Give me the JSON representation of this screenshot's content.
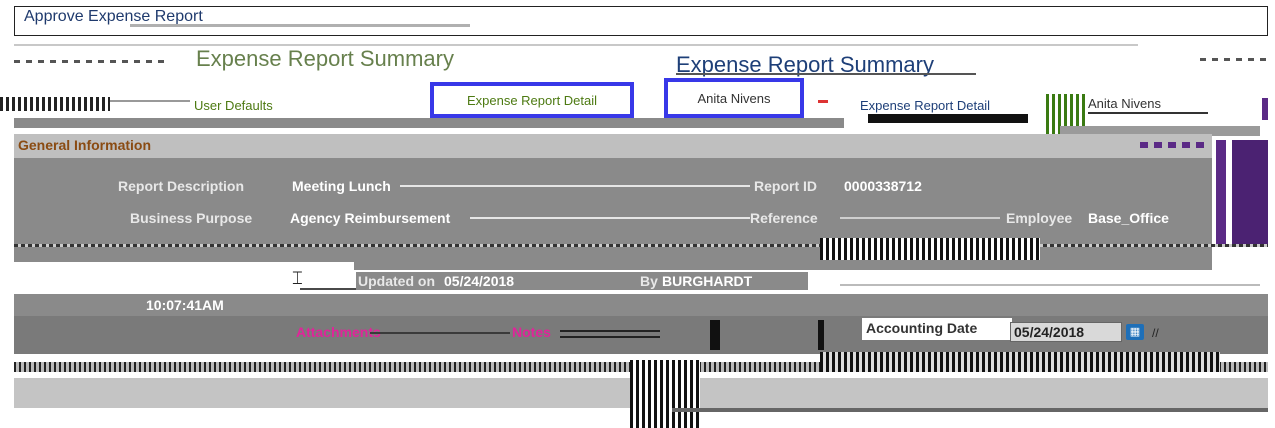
{
  "page": {
    "title": "Approve Expense Report"
  },
  "header": {
    "left_section_title": "Expense Report Summary",
    "summary_title": "Expense Report Summary",
    "employee_name": "Anita Nivens"
  },
  "nav": {
    "user_defaults": "User Defaults",
    "expense_report_detail_link": "Expense Report Detail",
    "expense_report_detail_selected": "Expense Report Detail",
    "employee_selector": "Anita Nivens",
    "expense_report_detail_tab": "Expense Report Detail",
    "employee_tab": "Anita Nivens"
  },
  "general": {
    "section_label": "General Information",
    "report_description_label": "Report Description",
    "report_description_value": "Meeting Lunch",
    "report_id_label": "Report ID",
    "report_id_value": "0000338712",
    "business_purpose_label": "Business Purpose",
    "business_purpose_value": "Agency Reimbursement",
    "reference_label": "Reference",
    "employee_label": "Employee",
    "employee_value": "Base_Office",
    "updated_label": "Updated on",
    "updated_value": "05/24/2018",
    "by_label": "By",
    "by_value": "BURGHARDT",
    "time_value": "10:07:41AM",
    "attachments_link": "Attachments",
    "notes_link": "Notes",
    "accounting_date_label": "Accounting Date",
    "accounting_date_value": "05/24/2018"
  },
  "icons": {
    "calendar": "calendar-icon",
    "text_cursor": "text-cursor-icon"
  }
}
